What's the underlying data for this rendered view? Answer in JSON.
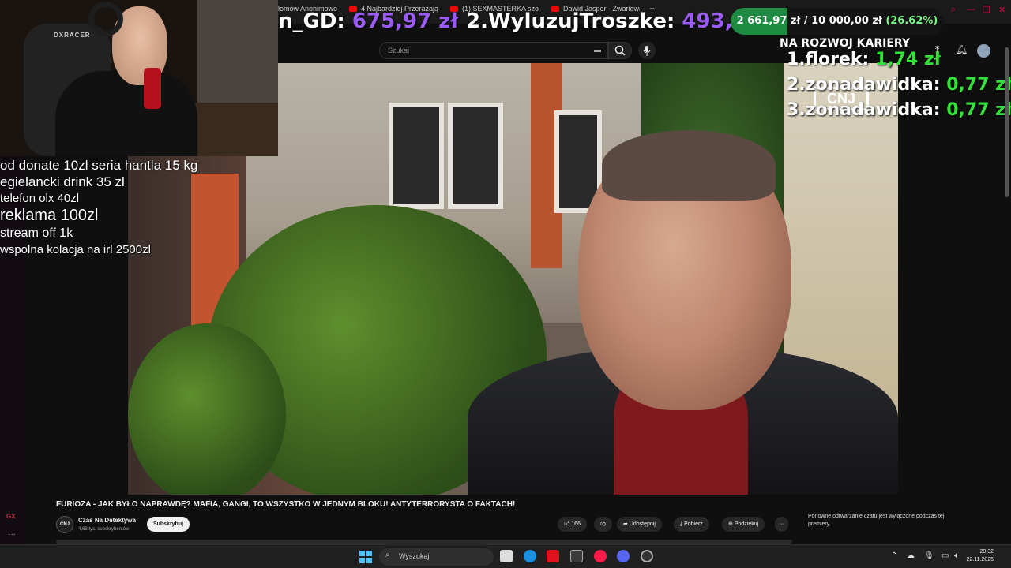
{
  "browser": {
    "tabs": [
      {
        "label": "łomów Anonimowo"
      },
      {
        "label": "4 Najbardziej Przerażające"
      },
      {
        "label": "(1) SEXMASTERKA szok"
      },
      {
        "label": "Dawid Jasper - Zwariowa"
      }
    ],
    "new_tab": "+"
  },
  "youtube": {
    "search_placeholder": "Szukaj",
    "video_title": "FURIOZA - JAK BYŁO NAPRAWDĘ? MAFIA, GANGI, TO WSZYSTKO W JEDNYM BLOKU! ANTYTERRORYSTA O FAKTACH!",
    "channel_name": "Czas Na Detektywa",
    "channel_avatar_text": "CNJ",
    "subscribers": "4,63 tys. subskrybentów",
    "subscribe_label": "Subskrybuj",
    "likes": "166",
    "share_label": "Udostępnij",
    "download_label": "Pobierz",
    "thanks_label": "Podziękuj",
    "more_label": "···",
    "chat_disabled_text": "Ponowne odtwarzanie czatu jest wyłączone podczas tej premiery.",
    "watermark": "CNJ"
  },
  "overlay": {
    "top_donors": [
      {
        "name": "n_GD: ",
        "amount": "675,97 zł"
      },
      {
        "name": "2.WyluzujTroszke: ",
        "amount": "493,"
      }
    ],
    "goal": {
      "current": "2 661,97 zł",
      "separator": " / ",
      "target": "10 000,00 zł",
      "percent_label": "(26.62%)",
      "fraction": 0.2662
    },
    "career_title": "NA ROZWOJ KARIERY",
    "ranking": [
      {
        "name": "1.florek: ",
        "amount": "1,74 zł"
      },
      {
        "name": "2.zonadawidka: ",
        "amount": "0,77 zł"
      },
      {
        "name": "3.zonadawidka: ",
        "amount": "0,77 zł"
      }
    ],
    "commands": [
      "od donate 10zl seria hantla 15 kg",
      "egielancki drink 35 zl",
      "telefon olx 40zl",
      "reklama 100zl",
      "stream off 1k",
      "wspolna kolacja na irl 2500zl"
    ]
  },
  "webcam": {
    "chair_brand": "DXRACER"
  },
  "sidebar": {
    "gx_label": "GX",
    "more": "···"
  },
  "taskbar": {
    "search_placeholder": "Wyszukaj",
    "time": "20:32",
    "date": "22.11.2025"
  },
  "colors": {
    "accent_purple": "#9b5cf5",
    "accent_green": "#34e33a",
    "youtube_red": "#ff0000"
  }
}
